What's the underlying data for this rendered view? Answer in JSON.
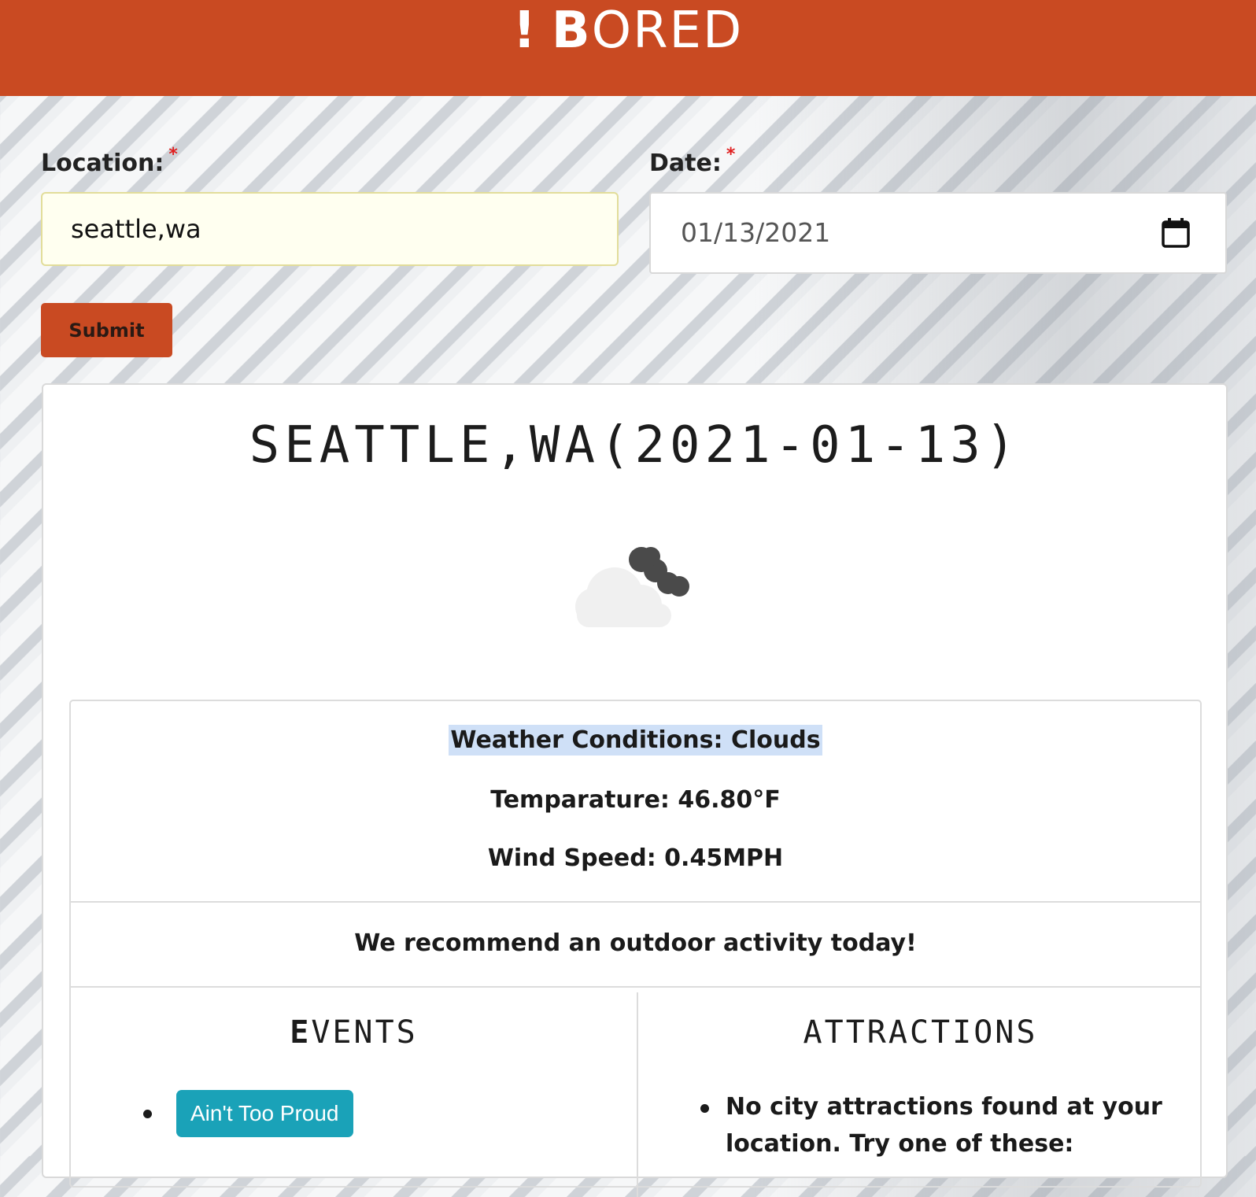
{
  "header": {
    "brand_bang": "!",
    "brand_b": "B",
    "brand_rest": "ORED"
  },
  "form": {
    "location_label": "Location:",
    "date_label": "Date:",
    "required_mark": "*",
    "location_value": "seattle,wa",
    "date_value": "01/13/2021",
    "submit_label": "Submit"
  },
  "result": {
    "title": "SEATTLE,WA(2021-01-13)",
    "weather_icon": "clouds-icon",
    "conditions": "Weather Conditions: Clouds",
    "temperature": "Temparature: 46.80°F",
    "wind": "Wind Speed: 0.45MPH",
    "recommendation": "We recommend an outdoor activity today!",
    "events_title_first": "E",
    "events_title_rest": "VENTS",
    "attractions_title": "ATTRACTIONS",
    "events": [
      {
        "label": "Ain't Too Proud"
      }
    ],
    "attractions_message": "No city attractions found at your location. Try one of these:"
  },
  "colors": {
    "brand": "#c94a22",
    "event_button": "#1aa2b8",
    "highlight": "#cfe0f7",
    "required": "#e02020"
  }
}
